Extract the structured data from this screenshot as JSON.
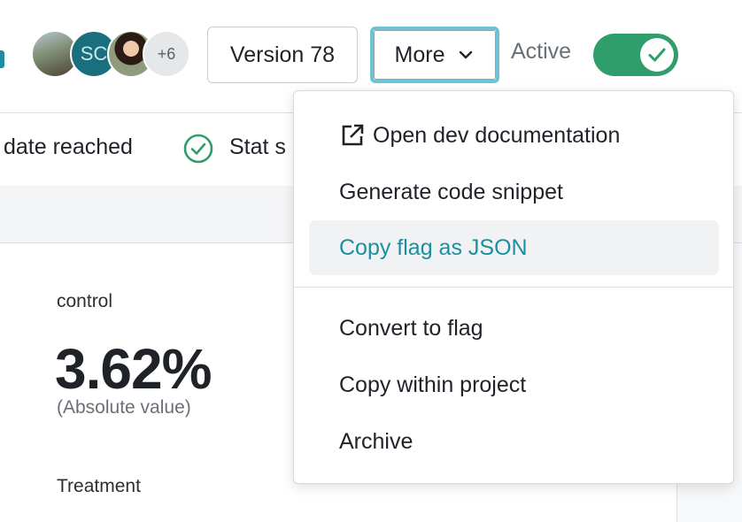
{
  "header": {
    "avatars": [
      {
        "kind": "photo",
        "initials": ""
      },
      {
        "kind": "initials",
        "initials": "SC"
      },
      {
        "kind": "photo",
        "initials": ""
      },
      {
        "kind": "overflow",
        "initials": "+6"
      }
    ],
    "version_label": "Version 78",
    "more_label": "More",
    "active_label": "Active",
    "active_toggle_on": true
  },
  "status_row": {
    "item1": "date reached",
    "item2": "Stat s"
  },
  "content": {
    "control_label": "control",
    "control_value": "3.62%",
    "control_sub": "(Absolute value)",
    "treatment_label": "Treatment"
  },
  "menu": {
    "items": [
      {
        "label": "Open dev documentation",
        "icon": "external-link-icon"
      },
      {
        "label": "Generate code snippet"
      },
      {
        "label": "Copy flag as JSON",
        "highlighted": true
      },
      {
        "label": "Convert to flag"
      },
      {
        "label": "Copy within project"
      },
      {
        "label": "Archive"
      }
    ]
  },
  "colors": {
    "accent": "#1b8fa0",
    "toggle_on": "#2f9e6a",
    "focus_ring": "#6cc3d4",
    "status_check": "#2f9e6a"
  }
}
